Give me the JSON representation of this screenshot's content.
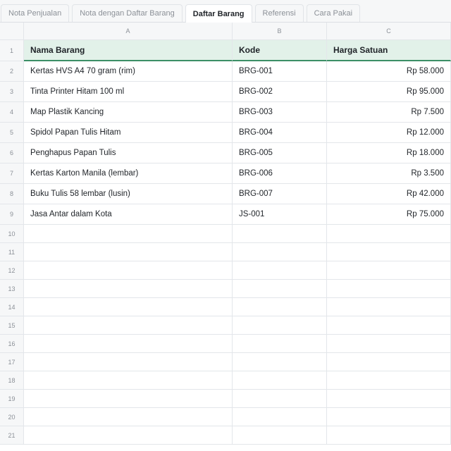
{
  "tabs": [
    {
      "label": "Nota Penjualan",
      "active": false
    },
    {
      "label": "Nota dengan Daftar Barang",
      "active": false
    },
    {
      "label": "Daftar Barang",
      "active": true
    },
    {
      "label": "Referensi",
      "active": false
    },
    {
      "label": "Cara Pakai",
      "active": false
    }
  ],
  "columns": [
    "A",
    "B",
    "C"
  ],
  "header_row": {
    "num": "1",
    "cells": [
      "Nama Barang",
      "Kode",
      "Harga Satuan"
    ]
  },
  "rows": [
    {
      "num": "2",
      "name": "Kertas HVS A4 70 gram (rim)",
      "code": "BRG-001",
      "price": "Rp 58.000"
    },
    {
      "num": "3",
      "name": "Tinta Printer Hitam 100 ml",
      "code": "BRG-002",
      "price": "Rp 95.000"
    },
    {
      "num": "4",
      "name": "Map Plastik Kancing",
      "code": "BRG-003",
      "price": "Rp 7.500"
    },
    {
      "num": "5",
      "name": "Spidol Papan Tulis Hitam",
      "code": "BRG-004",
      "price": "Rp 12.000"
    },
    {
      "num": "6",
      "name": "Penghapus Papan Tulis",
      "code": "BRG-005",
      "price": "Rp 18.000"
    },
    {
      "num": "7",
      "name": "Kertas Karton Manila (lembar)",
      "code": "BRG-006",
      "price": "Rp 3.500"
    },
    {
      "num": "8",
      "name": "Buku Tulis 58 lembar (lusin)",
      "code": "BRG-007",
      "price": "Rp 42.000"
    },
    {
      "num": "9",
      "name": "Jasa Antar dalam Kota",
      "code": "JS-001",
      "price": "Rp 75.000"
    }
  ],
  "empty_rows": [
    "10",
    "11",
    "12",
    "13",
    "14",
    "15",
    "16",
    "17",
    "18",
    "19",
    "20",
    "21"
  ]
}
